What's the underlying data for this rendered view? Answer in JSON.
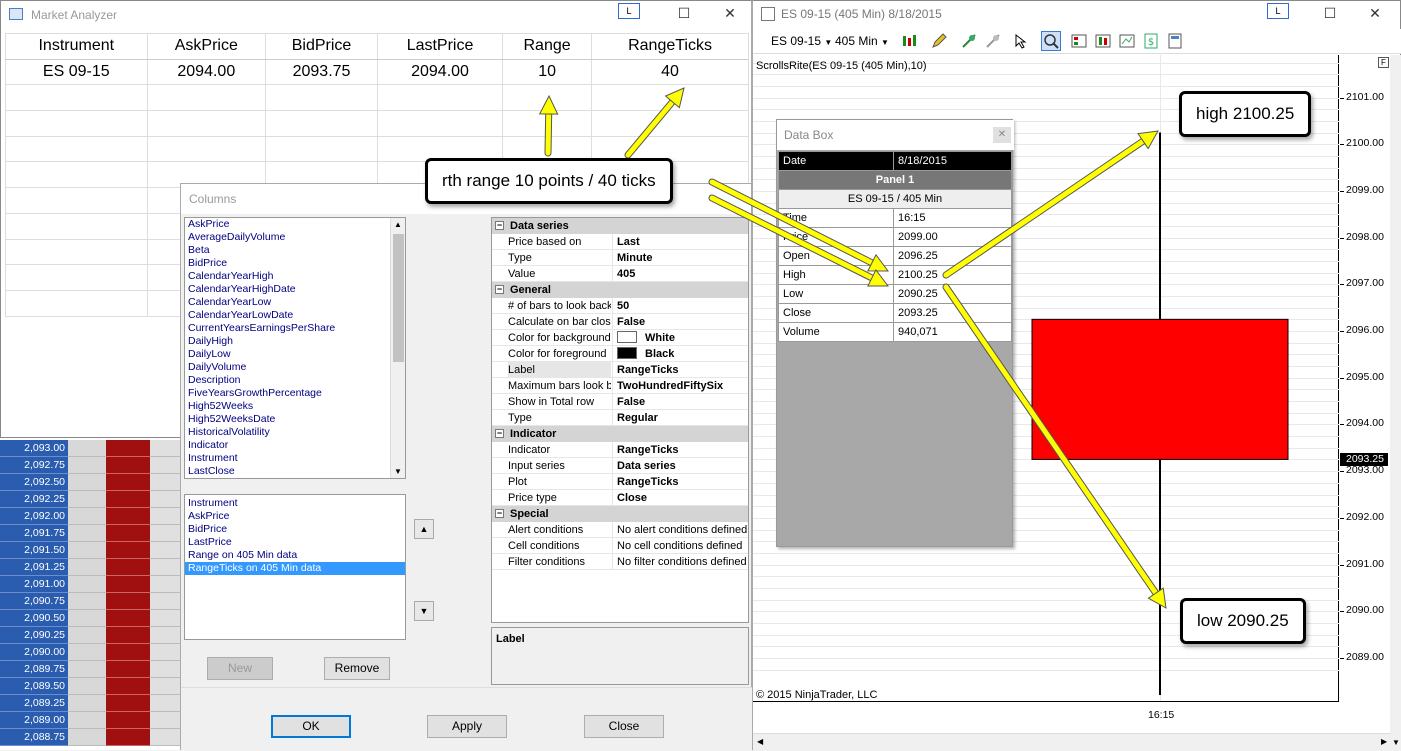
{
  "market_analyzer": {
    "title": "Market Analyzer",
    "headers": [
      "Instrument",
      "AskPrice",
      "BidPrice",
      "LastPrice",
      "Range",
      "RangeTicks"
    ],
    "row": [
      "ES 09-15",
      "2094.00",
      "2093.75",
      "2094.00",
      "10",
      "40"
    ],
    "link_button": "L"
  },
  "ladder": {
    "prices": [
      "2,093.00",
      "2,092.75",
      "2,092.50",
      "2,092.25",
      "2,092.00",
      "2,091.75",
      "2,091.50",
      "2,091.25",
      "2,091.00",
      "2,090.75",
      "2,090.50",
      "2,090.25",
      "2,090.00",
      "2,089.75",
      "2,089.50",
      "2,089.25",
      "2,089.00",
      "2,088.75"
    ]
  },
  "columns_dialog": {
    "title": "Columns",
    "available": [
      "AskPrice",
      "AverageDailyVolume",
      "Beta",
      "BidPrice",
      "CalendarYearHigh",
      "CalendarYearHighDate",
      "CalendarYearLow",
      "CalendarYearLowDate",
      "CurrentYearsEarningsPerShare",
      "DailyHigh",
      "DailyLow",
      "DailyVolume",
      "Description",
      "FiveYearsGrowthPercentage",
      "High52Weeks",
      "High52WeeksDate",
      "HistoricalVolatility",
      "Indicator",
      "Instrument",
      "LastClose"
    ],
    "selected": [
      "Instrument",
      "AskPrice",
      "BidPrice",
      "LastPrice",
      "Range on 405 Min data",
      "RangeTicks on 405 Min data"
    ],
    "new_label": "New",
    "remove_label": "Remove",
    "ok_label": "OK",
    "apply_label": "Apply",
    "close_label": "Close",
    "up_glyph": "▲",
    "down_glyph": "▼",
    "description_label": "Label",
    "properties": {
      "data_series": {
        "name": "Data series",
        "rows": [
          [
            "Price based on",
            "Last"
          ],
          [
            "Type",
            "Minute"
          ],
          [
            "Value",
            "405"
          ]
        ]
      },
      "general": {
        "name": "General",
        "rows": [
          [
            "# of bars to look back",
            "50"
          ],
          [
            "Calculate on bar close",
            "False"
          ],
          [
            "Color for background",
            "White"
          ],
          [
            "Color for foreground",
            "Black"
          ],
          [
            "Label",
            "RangeTicks"
          ],
          [
            "Maximum bars look back",
            "TwoHundredFiftySix"
          ],
          [
            "Show in Total row",
            "False"
          ],
          [
            "Type",
            "Regular"
          ]
        ]
      },
      "indicator": {
        "name": "Indicator",
        "rows": [
          [
            "Indicator",
            "RangeTicks"
          ],
          [
            "Input series",
            "Data series"
          ],
          [
            "Plot",
            "RangeTicks"
          ],
          [
            "Price type",
            "Close"
          ]
        ]
      },
      "special": {
        "name": "Special",
        "rows": [
          [
            "Alert conditions",
            "No alert conditions defined"
          ],
          [
            "Cell conditions",
            "No cell conditions defined"
          ],
          [
            "Filter conditions",
            "No filter conditions defined"
          ]
        ]
      }
    },
    "colors": {
      "background": "#ffffff",
      "foreground": "#000000"
    }
  },
  "chart": {
    "title": "ES 09-15 (405 Min)  8/18/2015",
    "instrument": "ES 09-15",
    "interval": "405 Min",
    "indicator_label": "ScrollsRite(ES 09-15 (405 Min),10)",
    "copyright": "© 2015 NinjaTrader, LLC",
    "time_label": "16:15",
    "price_labels": [
      "2101.00",
      "2100.00",
      "2099.00",
      "2098.00",
      "2097.00",
      "2096.00",
      "2095.00",
      "2094.00",
      "2093.00",
      "2092.00",
      "2091.00",
      "2090.00",
      "2089.00"
    ],
    "current_price": "2093.25",
    "f_label": "F",
    "candle": {
      "open": 2096.25,
      "high": 2100.25,
      "low": 2090.25,
      "close": 2093.25,
      "color": "#ff0000"
    }
  },
  "data_box": {
    "title": "Data Box",
    "date_label": "Date",
    "date_value": "8/18/2015",
    "panel": "Panel 1",
    "series": "ES 09-15 / 405 Min",
    "rows": [
      [
        "Time",
        "16:15"
      ],
      [
        "Price",
        "2099.00"
      ],
      [
        "Open",
        "2096.25"
      ],
      [
        "High",
        "2100.25"
      ],
      [
        "Low",
        "2090.25"
      ],
      [
        "Close",
        "2093.25"
      ],
      [
        "Volume",
        "940,071"
      ]
    ]
  },
  "annotations": {
    "range_note": "rth range 10 points / 40 ticks",
    "high_note": "high 2100.25",
    "low_note": "low 2090.25",
    "arrow_color": "#ffff00"
  }
}
